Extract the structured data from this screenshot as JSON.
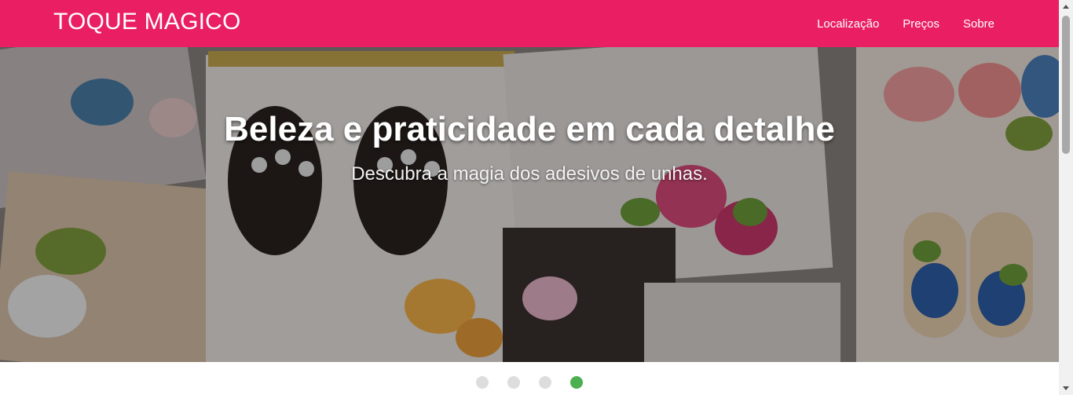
{
  "navbar": {
    "brand": "TOQUE MAGICO",
    "links": [
      "Localização",
      "Preços",
      "Sobre"
    ],
    "background_color": "#e91e63"
  },
  "hero": {
    "title": "Beleza e praticidade em cada detalhe",
    "subtitle": "Descubra a magia dos adesivos de unhas."
  },
  "carousel": {
    "slide_count": 4,
    "active_index": 3,
    "active_color": "#4caf50",
    "inactive_color": "#dddddd"
  }
}
